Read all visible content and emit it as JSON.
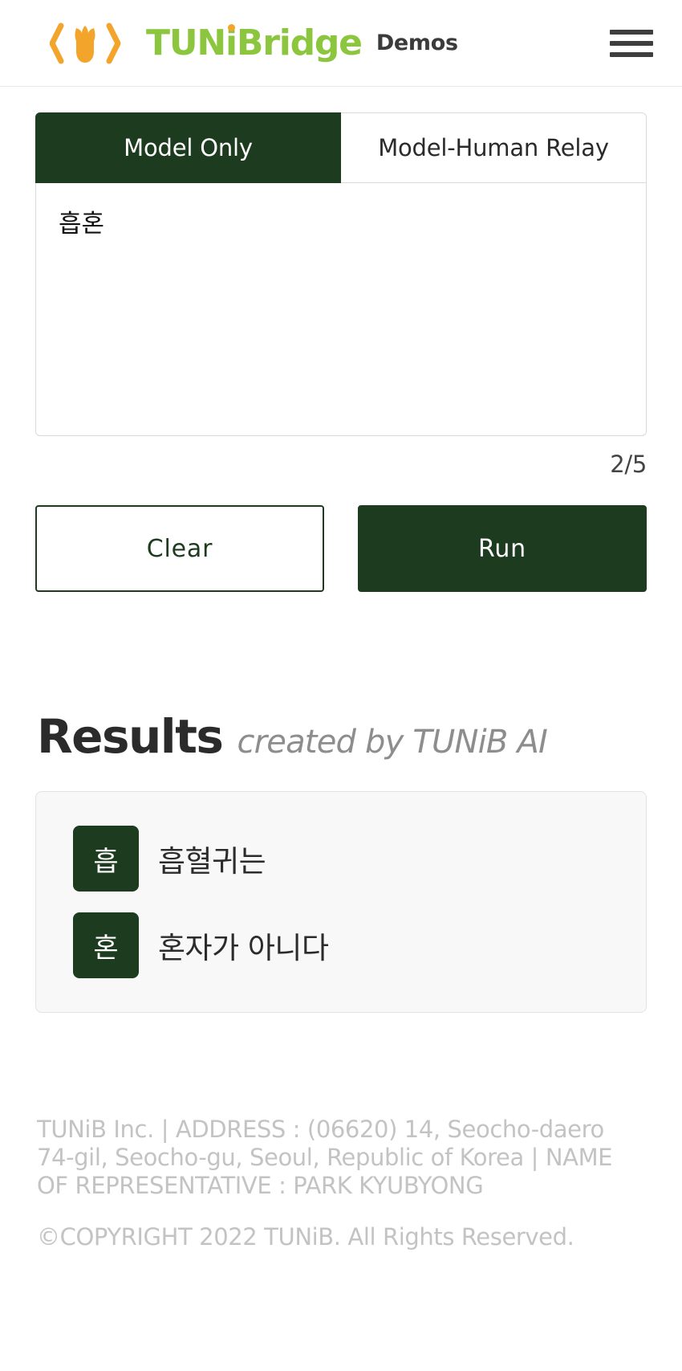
{
  "header": {
    "logo_prefix": "‹",
    "logo_suffix": "›",
    "logo_text_1": "TUN",
    "logo_text_2": "i",
    "logo_text_3": "Bridge",
    "page_label": "Demos",
    "menu_icon": "hamburger-menu-icon"
  },
  "tabs": [
    {
      "label": "Model Only",
      "active": true
    },
    {
      "label": "Model-Human Relay",
      "active": false
    }
  ],
  "composer": {
    "value": "흡혼",
    "placeholder": "",
    "counter": "2/5"
  },
  "actions": {
    "clear_label": "Clear",
    "run_label": "Run"
  },
  "results": {
    "title": "Results",
    "subtitle": "created by TUNiB AI",
    "rows": [
      {
        "badge": "흡",
        "text": "흡혈귀는"
      },
      {
        "badge": "혼",
        "text": "혼자가 아니다"
      }
    ]
  },
  "footer": {
    "info": "TUNiB Inc. | ADDRESS : (06620) 14, Seocho-daero 74-gil, Seocho-gu, Seoul, Republic of Korea | NAME OF REPRESENTATIVE : PARK KYUBYONG",
    "copyright": "©COPYRIGHT 2022 TUNiB. All Rights Reserved."
  },
  "colors": {
    "brand_green": "#8cc63e",
    "brand_orange": "#f2a42b",
    "dark_green": "#1d3b1e"
  }
}
